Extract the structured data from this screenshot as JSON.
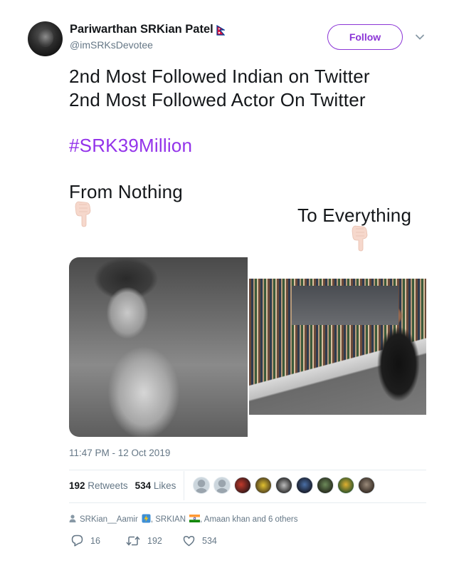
{
  "author": {
    "display_name": "Pariwarthan SRKian Patel",
    "handle": "@imSRKsDevotee",
    "flag_icon": "nepal-flag-icon"
  },
  "follow_label": "Follow",
  "tweet": {
    "line1": "2nd Most Followed Indian on Twitter",
    "line2": "2nd Most Followed Actor On Twitter",
    "hashtag": "#SRK39Million",
    "line3": "From Nothing",
    "line4": "To Everything",
    "emoji_icon": "pointing-down-hand-icon"
  },
  "timestamp": "11:47 PM - 12 Oct 2019",
  "stats": {
    "retweets_count": "192",
    "retweets_label": "Retweets",
    "likes_count": "534",
    "likes_label": "Likes"
  },
  "liked_by": {
    "text_1": "SRKian__Aamir",
    "text_2": ", SRKIAN",
    "text_3": ", Amaan khan and 6 others"
  },
  "actions": {
    "replies": "16",
    "retweets": "192",
    "likes": "534"
  },
  "colors": {
    "accent": "#8b35d6",
    "hashtag": "#9333ea",
    "secondary_text": "#657786"
  }
}
